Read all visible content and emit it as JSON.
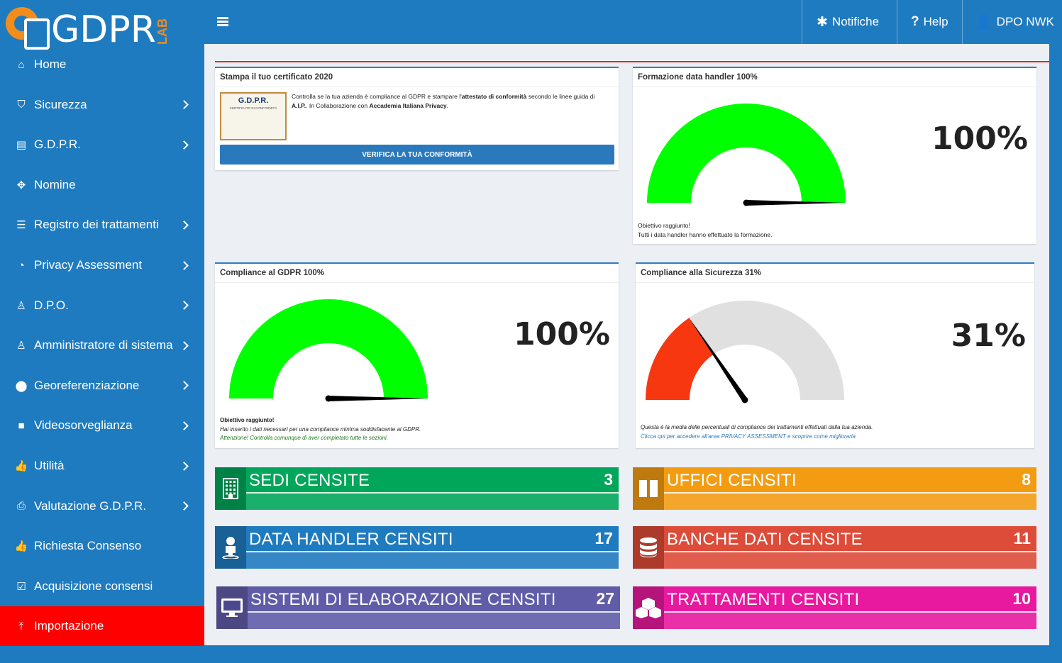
{
  "logo": {
    "text": "GDPR",
    "suffix": "LAB"
  },
  "sidebar": {
    "items": [
      {
        "label": "Home",
        "icon": "home-icon",
        "glyph": "⌂",
        "chevron": false,
        "active": false
      },
      {
        "label": "Sicurezza",
        "icon": "shield-icon",
        "glyph": "⛉",
        "chevron": true,
        "active": false
      },
      {
        "label": "G.D.P.R.",
        "icon": "book-icon",
        "glyph": "▤",
        "chevron": true,
        "active": false
      },
      {
        "label": "Nomine",
        "icon": "crosshair-icon",
        "glyph": "✥",
        "chevron": false,
        "active": false
      },
      {
        "label": "Registro dei trattamenti",
        "icon": "list-icon",
        "glyph": "☰",
        "chevron": true,
        "active": false
      },
      {
        "label": "Privacy Assessment",
        "icon": "dashboard-icon",
        "glyph": "◔",
        "chevron": true,
        "active": false
      },
      {
        "label": "D.P.O.",
        "icon": "user-icon",
        "glyph": "♙",
        "chevron": true,
        "active": false
      },
      {
        "label": "Amministratore di sistema",
        "icon": "user-icon",
        "glyph": "♙",
        "chevron": true,
        "active": false
      },
      {
        "label": "Georeferenziazione",
        "icon": "map-marker-icon",
        "glyph": "⬤",
        "chevron": true,
        "active": false
      },
      {
        "label": "Videosorveglianza",
        "icon": "video-camera-icon",
        "glyph": "■",
        "chevron": true,
        "active": false
      },
      {
        "label": "Utilità",
        "icon": "thumbs-up-icon",
        "glyph": "👍",
        "chevron": true,
        "active": false
      },
      {
        "label": "Valutazione G.D.P.R.",
        "icon": "print-icon",
        "glyph": "⎙",
        "chevron": true,
        "active": false
      },
      {
        "label": "Richiesta Consenso",
        "icon": "thumbs-up-icon",
        "glyph": "👍",
        "chevron": false,
        "active": false
      },
      {
        "label": "Acquisizione consensi",
        "icon": "check-square-icon",
        "glyph": "☑",
        "chevron": false,
        "active": false
      },
      {
        "label": "Importazione",
        "icon": "upload-icon",
        "glyph": "⤒",
        "chevron": false,
        "active": true
      }
    ]
  },
  "topbar": {
    "notifications_label": "Notifiche",
    "help_label": "Help",
    "user_label": "DPO NWK"
  },
  "colors": {
    "primary": "#1f7bbf",
    "active": "#ff0000",
    "gauge_green": "#00ff00",
    "gauge_red": "#f7370f",
    "gauge_grey": "#e0e0e0"
  },
  "certificate": {
    "title": "Stampa il tuo certificato 2020",
    "image_title": "G.D.P.R.",
    "image_subtitle": "CERTIFICATO DI CONFORMITÀ",
    "text_a": "Controlla se la tua azienda è compliance al GDPR e stampare l'",
    "text_b": "attestato di conformità",
    "text_c": " secondo le linee guida di ",
    "text_d": "A.I.P.",
    "text_e": ". In Collaborazione con ",
    "text_f": "Accademia Italiana Privacy",
    "text_g": ".",
    "button_label": "VERIFICA LA TUA CONFORMITÀ"
  },
  "gauges": {
    "formazione": {
      "title": "Formazione data handler 100%",
      "value": 100,
      "display": "100%",
      "note1": "Obiettivo raggiunto!",
      "note2": "Tutti i data handler hanno effettuato la formazione."
    },
    "gdpr": {
      "title": "Compliance al GDPR 100%",
      "value": 100,
      "display": "100%",
      "note1": "Obiettivo raggiunto!",
      "note2": "Hai inserito i dati necessari per una compliance minima soddisfacente al GDPR.",
      "note3": "Attenzione! Controlla comunque di aver completato tutte le sezioni."
    },
    "sicurezza": {
      "title": "Compliance alla Sicurezza 31%",
      "value": 31,
      "display": "31%",
      "note1": "Questa è la media delle percentuali di compliance dei trattamenti effettuati dalla tua azienda.",
      "note2": "Clicca qui per accedere all'area PRIVACY ASSESSMENT e scoprire come migliorarla"
    }
  },
  "stats": {
    "sedi": {
      "label": "SEDI CENSITE",
      "value": "3",
      "icon": "building-icon",
      "color": "#00a65a"
    },
    "uffici": {
      "label": "UFFICI CENSITI",
      "value": "8",
      "icon": "columns-icon",
      "color": "#f39c12"
    },
    "data_handler": {
      "label": "DATA HANDLER CENSITI",
      "value": "17",
      "icon": "user-icon",
      "color": "#1f7bbf"
    },
    "banche_dati": {
      "label": "BANCHE DATI CENSITE",
      "value": "11",
      "icon": "database-icon",
      "color": "#dd4b39"
    },
    "sistemi": {
      "label": "SISTEMI DI ELABORAZIONE CENSITI",
      "value": "27",
      "icon": "desktop-icon",
      "color": "#605ca8"
    },
    "trattamenti": {
      "label": "TRATTAMENTI CENSITI",
      "value": "10",
      "icon": "cubes-icon",
      "color": "#e8199e"
    }
  }
}
